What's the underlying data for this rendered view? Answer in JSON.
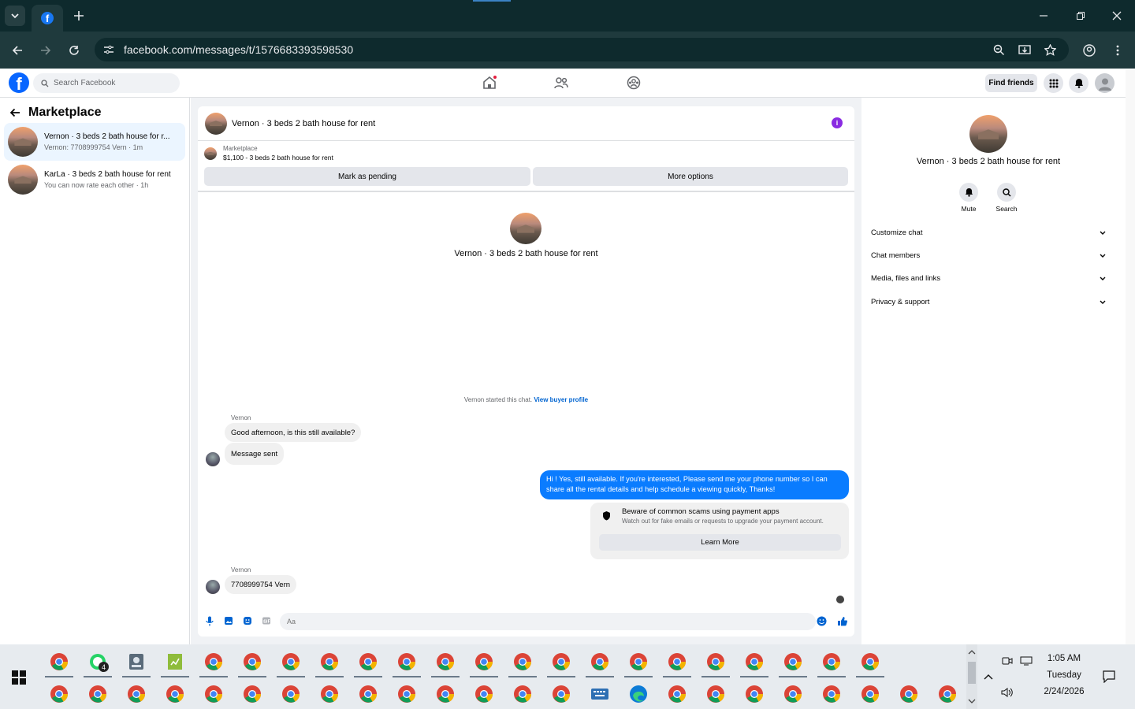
{
  "browser": {
    "url": "facebook.com/messages/t/1576683393598530"
  },
  "header": {
    "search_placeholder": "Search Facebook",
    "find_friends": "Find friends"
  },
  "left": {
    "title": "Marketplace",
    "conversations": [
      {
        "title": "Vernon · 3 beds 2 bath house for r...",
        "sub": "Vernon: 7708999754 Vern · 1m"
      },
      {
        "title": "KarLa · 3 beds 2 bath house for rent",
        "sub": "You can now rate each other · 1h"
      }
    ]
  },
  "chat": {
    "title": "Vernon · 3 beds 2 bath house for rent",
    "listing_label": "Marketplace",
    "listing_value": "$1,100 - 3 beds 2 bath house for rent",
    "mark_pending": "Mark as pending",
    "more_options": "More options",
    "center_title": "Vernon · 3 beds 2 bath house for rent",
    "started_text": "Vernon started this chat. ",
    "view_buyer": "View buyer profile",
    "messages": [
      {
        "sender": "Vernon",
        "text": "Good afternoon, is this still available?"
      },
      {
        "text": "Message sent"
      },
      {
        "out": "Hi ! Yes, still available. If you're interested, Please send me your phone number so I can share all the rental details and help schedule a viewing quickly, Thanks!"
      },
      {
        "sender": "Vernon",
        "text": "7708999754 Vern"
      }
    ],
    "scam": {
      "title": "Beware of common scams using payment apps",
      "desc": "Watch out for fake emails or requests to upgrade your payment account.",
      "button": "Learn More"
    },
    "input_placeholder": "Aa"
  },
  "right": {
    "title": "Vernon · 3 beds 2 bath house for rent",
    "mute": "Mute",
    "search": "Search",
    "sections": [
      "Customize chat",
      "Chat members",
      "Media, files and links",
      "Privacy & support"
    ]
  },
  "taskbar": {
    "whatsapp_badge": "4",
    "time": "1:05 AM",
    "day": "Tuesday",
    "date": "2/24/2026"
  },
  "colors": {
    "accent": "#0a7cff",
    "fb_blue": "#0866ff",
    "chrome_dark": "#0e2a2d"
  }
}
